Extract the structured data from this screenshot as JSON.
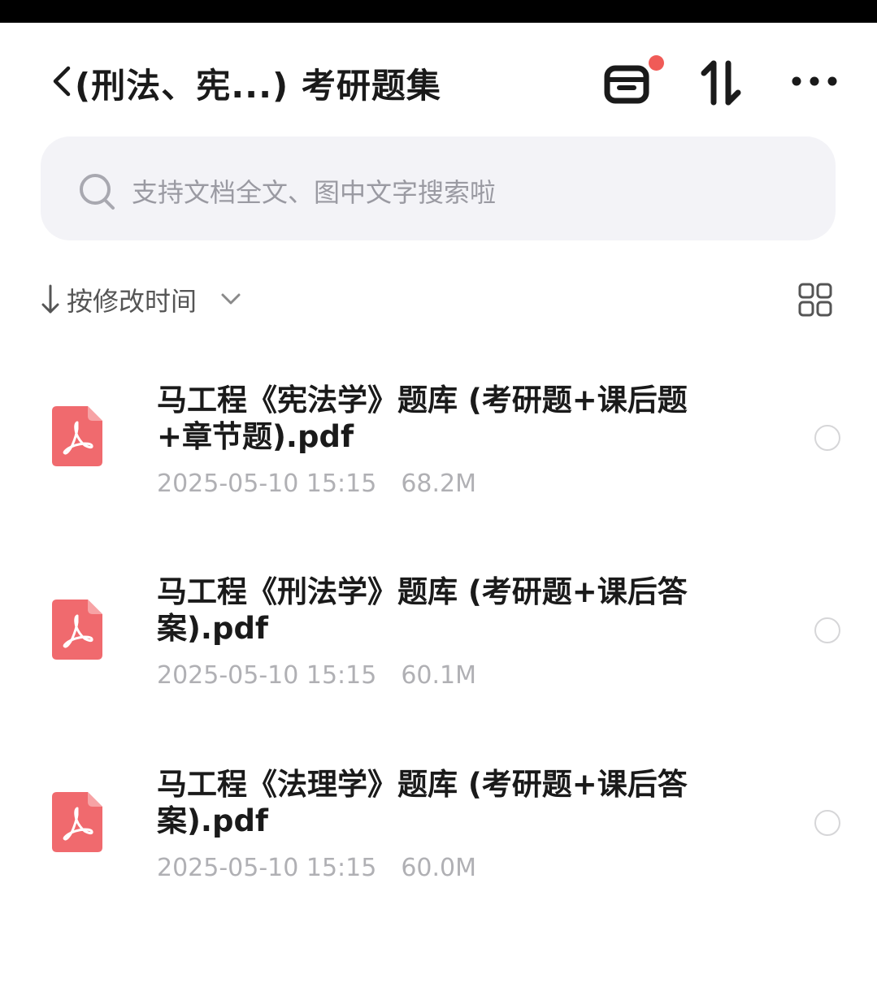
{
  "header": {
    "title": "(刑法、宪...) 考研题集",
    "icons": [
      "back-icon",
      "recycle-bin-icon",
      "sort-swap-icon",
      "more-icon"
    ],
    "notification_dot_color": "#f05b57"
  },
  "search": {
    "placeholder": "支持文档全文、图中文字搜索啦"
  },
  "sort": {
    "label": "按修改时间"
  },
  "files": [
    {
      "name": "马工程《宪法学》题库 (考研题+课后题+章节题).pdf",
      "date": "2025-05-10 15:15",
      "size": "68.2M",
      "icon": "pdf-icon"
    },
    {
      "name": "马工程《刑法学》题库 (考研题+课后答案).pdf",
      "date": "2025-05-10 15:15",
      "size": "60.1M",
      "icon": "pdf-icon"
    },
    {
      "name": "马工程《法理学》题库 (考研题+课后答案).pdf",
      "date": "2025-05-10 15:15",
      "size": "60.0M",
      "icon": "pdf-icon"
    }
  ],
  "colors": {
    "pdf_icon": "#f06a6e",
    "search_bg": "#f3f3f7",
    "meta_text": "#b0b0b4"
  }
}
